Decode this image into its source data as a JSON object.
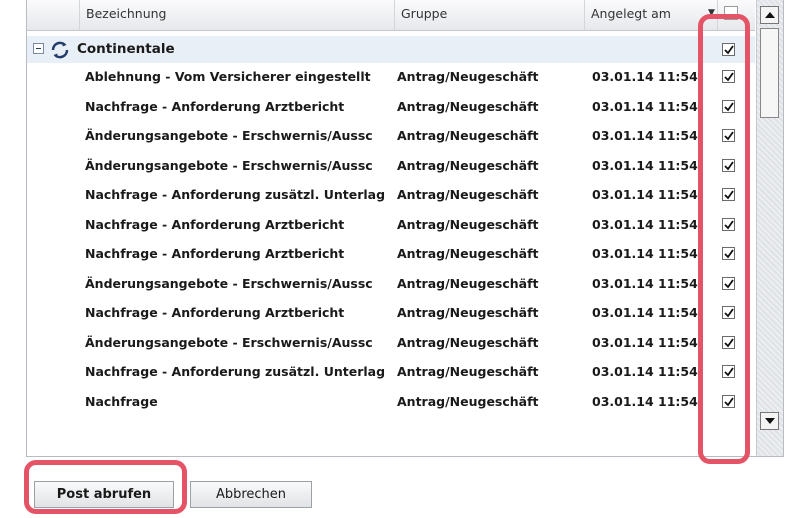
{
  "table": {
    "columns": {
      "name": "Bezeichnung",
      "group": "Gruppe",
      "created": "Angelegt am"
    },
    "group": {
      "label": "Continentale"
    },
    "rows": [
      {
        "name": "Ablehnung - Vom Versicherer eingestellt",
        "group": "Antrag/Neugeschäft",
        "created": "03.01.14 11:54"
      },
      {
        "name": "Nachfrage - Anforderung Arztbericht",
        "group": "Antrag/Neugeschäft",
        "created": "03.01.14 11:54"
      },
      {
        "name": "Änderungsangebote - Erschwernis/Aussc",
        "group": "Antrag/Neugeschäft",
        "created": "03.01.14 11:54"
      },
      {
        "name": "Änderungsangebote - Erschwernis/Aussc",
        "group": "Antrag/Neugeschäft",
        "created": "03.01.14 11:54"
      },
      {
        "name": "Nachfrage - Anforderung zusätzl. Unterlag",
        "group": "Antrag/Neugeschäft",
        "created": "03.01.14 11:54"
      },
      {
        "name": "Nachfrage - Anforderung Arztbericht",
        "group": "Antrag/Neugeschäft",
        "created": "03.01.14 11:54"
      },
      {
        "name": "Nachfrage - Anforderung Arztbericht",
        "group": "Antrag/Neugeschäft",
        "created": "03.01.14 11:54"
      },
      {
        "name": "Änderungsangebote - Erschwernis/Aussc",
        "group": "Antrag/Neugeschäft",
        "created": "03.01.14 11:54"
      },
      {
        "name": "Nachfrage - Anforderung Arztbericht",
        "group": "Antrag/Neugeschäft",
        "created": "03.01.14 11:54"
      },
      {
        "name": "Änderungsangebote - Erschwernis/Aussc",
        "group": "Antrag/Neugeschäft",
        "created": "03.01.14 11:54"
      },
      {
        "name": "Nachfrage - Anforderung zusätzl. Unterlag",
        "group": "Antrag/Neugeschäft",
        "created": "03.01.14 11:54"
      },
      {
        "name": "Nachfrage",
        "group": "Antrag/Neugeschäft",
        "created": "03.01.14 11:54"
      }
    ]
  },
  "buttons": {
    "fetch": "Post abrufen",
    "cancel": "Abbrechen"
  },
  "colors": {
    "highlight": "#e45466",
    "group_row": "#e9eff7"
  },
  "icons": {
    "expander": "collapse-minus-icon",
    "group": "refresh-folder-icon",
    "check": "checkmark-icon"
  }
}
